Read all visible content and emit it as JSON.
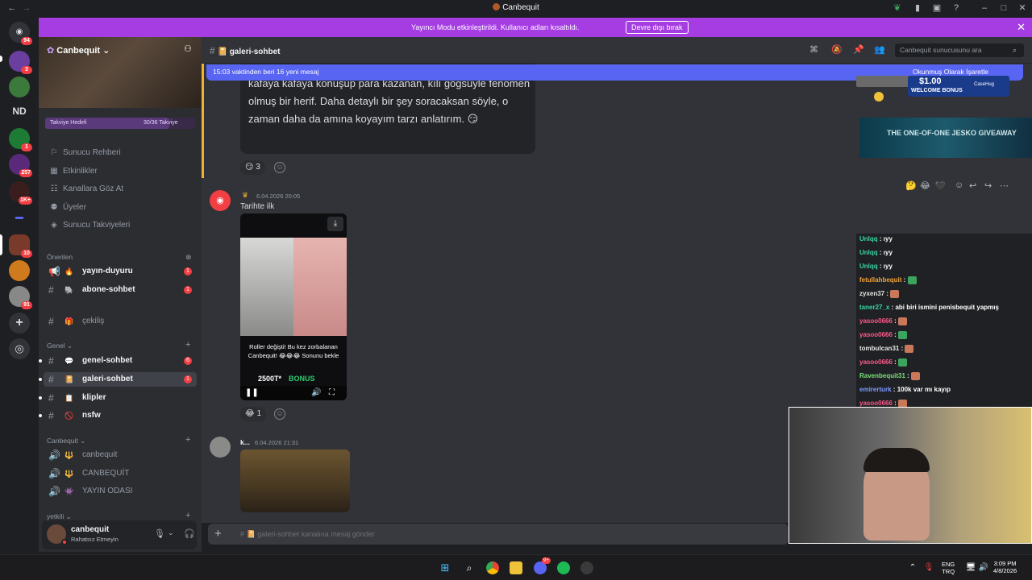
{
  "window": {
    "title": "Canbequit"
  },
  "notice": {
    "text": "Yayıncı Modu etkinleştirildi. Kullanıcı adları kısaltıldı.",
    "button": "Devre dışı bırak"
  },
  "guilds": {
    "badges": [
      "94",
      "3",
      "1",
      "257",
      "1K+",
      "10",
      "91"
    ],
    "nd_label": "ND"
  },
  "server": {
    "name": "Canbequit",
    "boost_label": "Takviye Hedefi",
    "boost_progress": "30/36 Takviye",
    "boost_fraction": 0.83,
    "nav": [
      "Sunucu Rehberi",
      "Etkinlikler",
      "Kanallara Göz At",
      "Üyeler",
      "Sunucu Takviyeleri"
    ],
    "sections": {
      "recommended": "Önerilen",
      "general": "Genel",
      "canbequit": "Canbequit",
      "staff": "yetkili"
    },
    "recommended_channels": [
      {
        "name": "yayın-duyuru",
        "badge": "1"
      },
      {
        "name": "abone-sohbet",
        "badge": "1"
      },
      {
        "name": "çekiliş",
        "badge": ""
      }
    ],
    "general_channels": [
      {
        "name": "genel-sohbet",
        "badge": "6"
      },
      {
        "name": "galeri-sohbet",
        "badge": "1"
      },
      {
        "name": "klipler",
        "badge": ""
      },
      {
        "name": "nsfw",
        "badge": ""
      }
    ],
    "voice_channels": [
      "canbequit",
      "CANBEQUİT",
      "YAYIN ODASI"
    ]
  },
  "user": {
    "name": "canbequit",
    "status": "Rahatsız Etmeyin"
  },
  "header": {
    "channel": "galeri-sohbet",
    "search_placeholder": "Canbequit sunucusunu ara"
  },
  "new_messages_bar": "15:03 vaktinden beri 16 yeni mesaj",
  "messages": [
    {
      "text": "kafaya kafaya konuşup para kazanan, kılı göğsüyle fenomen olmuş bir herif. Daha detaylı bir şey soracaksan söyle, o zaman daha da amına koyayım tarzı anlatırım. 😏",
      "reaction_count": "3"
    },
    {
      "timestamp": "6.04.2026 20:05",
      "text": "Tarihte ilk",
      "video_caption": "Roller değişti! Bu kez zorbalanan Canbequit! 😂😂😂 Sonunu bekle",
      "video_ad_left": "2500T*",
      "video_ad_right": "BONUS",
      "reaction_count": "1"
    },
    {
      "author": "k...",
      "timestamp": "6.04.2026 21:31"
    }
  ],
  "ads": {
    "top_badge": "Okunmuş Olarak İşaretle",
    "bonus_amount": "$1.00",
    "bonus_label": "WELCOME BONUS",
    "casino": "CaseHug",
    "giveaway": "THE ONE-OF-ONE JESKO GIVEAWAY"
  },
  "chat": [
    {
      "user": "Unlqq",
      "color": "#3ad7a4",
      "msg": "ıyy"
    },
    {
      "user": "Unlqq",
      "color": "#3ad7a4",
      "msg": "ıyy"
    },
    {
      "user": "Unlqq",
      "color": "#3ad7a4",
      "msg": "ıyy"
    },
    {
      "user": "fetullahbequit",
      "color": "#f0a43a",
      "msg": ""
    },
    {
      "user": "zyxen37",
      "color": "#e6e6e6",
      "msg": ""
    },
    {
      "user": "taner27_x",
      "color": "#3ad7a4",
      "msg": "abi biri ismini penisbequit yapmış"
    },
    {
      "user": "yasoo0666",
      "color": "#ff5a8a",
      "msg": ""
    },
    {
      "user": "yasoo0666",
      "color": "#ff5a8a",
      "msg": ""
    },
    {
      "user": "tombulcan31",
      "color": "#e6e6e6",
      "msg": ""
    },
    {
      "user": "yasoo0666",
      "color": "#ff5a8a",
      "msg": ""
    },
    {
      "user": "Ravenbequit31",
      "color": "#7be07b",
      "msg": ""
    },
    {
      "user": "emirerturk",
      "color": "#7b9bff",
      "msg": "100k var mı kayıp"
    },
    {
      "user": "yasoo0666",
      "color": "#ff5a8a",
      "msg": ""
    }
  ],
  "composer": {
    "placeholder": "galeri-sohbet kanalına mesaj gönder"
  },
  "taskbar": {
    "lang": "ENG",
    "layout": "TRQ",
    "time": "3:09 PM",
    "date": "4/8/2026",
    "discord_badge": "9+"
  },
  "colors": {
    "accent": "#5865f2",
    "notice": "#a53de2",
    "danger": "#f23f43"
  }
}
